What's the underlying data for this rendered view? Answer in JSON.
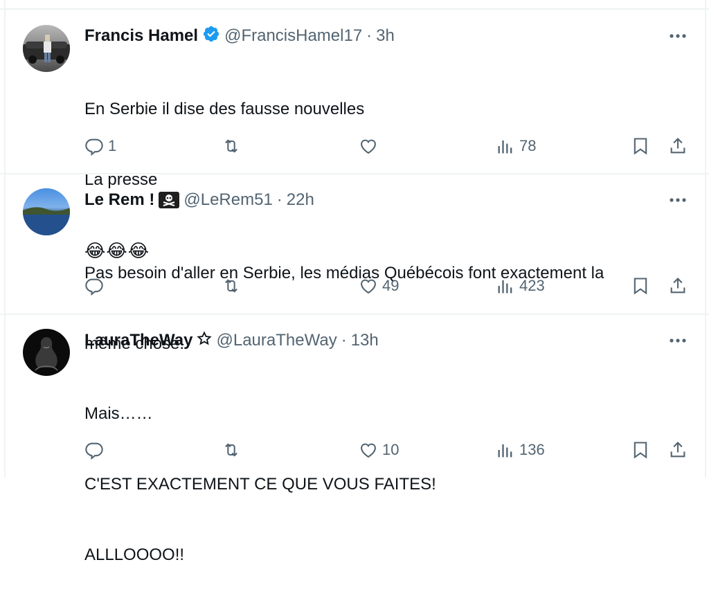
{
  "colors": {
    "text": "#0f1419",
    "muted": "#536471",
    "divider": "#eff3f4",
    "verified": "#1d9bf0"
  },
  "tweets": [
    {
      "name": "Francis Hamel",
      "handle": "@FrancisHamel17",
      "separator": "·",
      "time": "3h",
      "badge": "verified-icon",
      "lines": [
        "En Serbie il dise des fausse nouvelles",
        "La presse"
      ],
      "emoji": "😂😂😂",
      "replies": "1",
      "retweets": "",
      "likes": "",
      "views": "78"
    },
    {
      "name": "Le Rem !",
      "handle": "@LeRem51",
      "separator": "·",
      "time": "22h",
      "badge": "skull-crossbones-icon",
      "lines": [
        "Pas besoin d'aller en Serbie, les médias Québécois font exactement la",
        "même chose."
      ],
      "replies": "",
      "retweets": "",
      "likes": "49",
      "views": "423"
    },
    {
      "name": "LauraTheWay",
      "handle": "@LauraTheWay",
      "separator": "·",
      "time": "13h",
      "badge": "star-icon",
      "lines": [
        "Mais……",
        "C'EST EXACTEMENT CE QUE VOUS FAITES!",
        "ALLLOOOO!!"
      ],
      "replies": "",
      "retweets": "",
      "likes": "10",
      "views": "136"
    }
  ]
}
